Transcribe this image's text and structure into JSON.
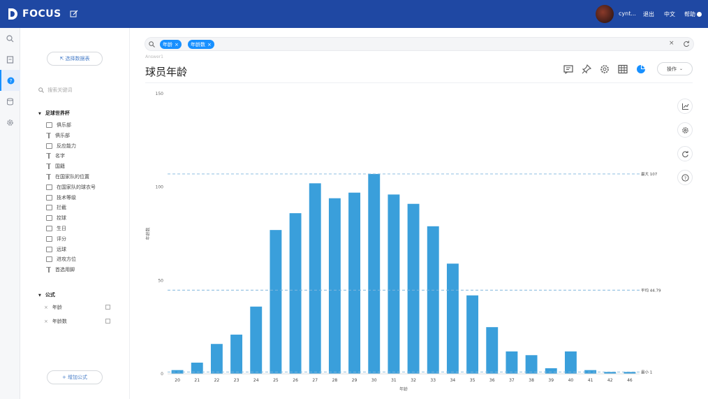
{
  "topbar": {
    "brand": "FOCUS",
    "username": "cynt...",
    "logout": "退出",
    "language": "中文",
    "help": "帮助"
  },
  "sidebar": {
    "select_source_button": "⇱ 选择数据表",
    "search_placeholder": "搜索关键词",
    "table_group": "足球世界杯",
    "columns": [
      {
        "label": "俱乐部",
        "icon": "numeric"
      },
      {
        "label": "俱乐部",
        "icon": "text"
      },
      {
        "label": "反应能力",
        "icon": "numeric"
      },
      {
        "label": "名字",
        "icon": "text"
      },
      {
        "label": "国籍",
        "icon": "text"
      },
      {
        "label": "在国家队的位置",
        "icon": "text"
      },
      {
        "label": "在国家队的球衣号",
        "icon": "numeric"
      },
      {
        "label": "技术等级",
        "icon": "numeric"
      },
      {
        "label": "拦截",
        "icon": "numeric"
      },
      {
        "label": "控球",
        "icon": "numeric"
      },
      {
        "label": "生日",
        "icon": "date"
      },
      {
        "label": "评分",
        "icon": "numeric"
      },
      {
        "label": "远球",
        "icon": "numeric"
      },
      {
        "label": "进攻方位",
        "icon": "numeric"
      },
      {
        "label": "首选用脚",
        "icon": "text"
      }
    ],
    "formula_group": "公式",
    "formulas": [
      "年龄",
      "年龄数"
    ],
    "add_formula_button": "+ 增加公式"
  },
  "search": {
    "tokens": [
      "年龄",
      "年龄数"
    ]
  },
  "answer": {
    "breadcrumb": "Answer1",
    "title": "球员年龄",
    "operate_button": "操作"
  },
  "chart_data": {
    "type": "bar",
    "title": "",
    "xlabel": "年龄",
    "ylabel": "年龄数",
    "ylim": [
      0,
      150
    ],
    "yticks": [
      0,
      50,
      100,
      150
    ],
    "grid": false,
    "bar_color": "#3a9fdb",
    "categories": [
      "20",
      "21",
      "22",
      "23",
      "24",
      "25",
      "26",
      "27",
      "28",
      "29",
      "30",
      "31",
      "32",
      "33",
      "34",
      "35",
      "36",
      "37",
      "38",
      "39",
      "40",
      "41",
      "42",
      "46"
    ],
    "values": [
      2,
      6,
      16,
      21,
      36,
      77,
      86,
      102,
      94,
      97,
      107,
      96,
      91,
      79,
      59,
      42,
      25,
      12,
      10,
      3,
      12,
      2,
      1,
      1
    ],
    "reference_lines": [
      {
        "label": "最大 107",
        "value": 107
      },
      {
        "label": "平均 44.79",
        "value": 44.79
      },
      {
        "label": "最小 1",
        "value": 1
      }
    ]
  },
  "colors": {
    "topbar": "#1f48a3",
    "accent": "#1890ff",
    "bar": "#3a9fdb"
  }
}
